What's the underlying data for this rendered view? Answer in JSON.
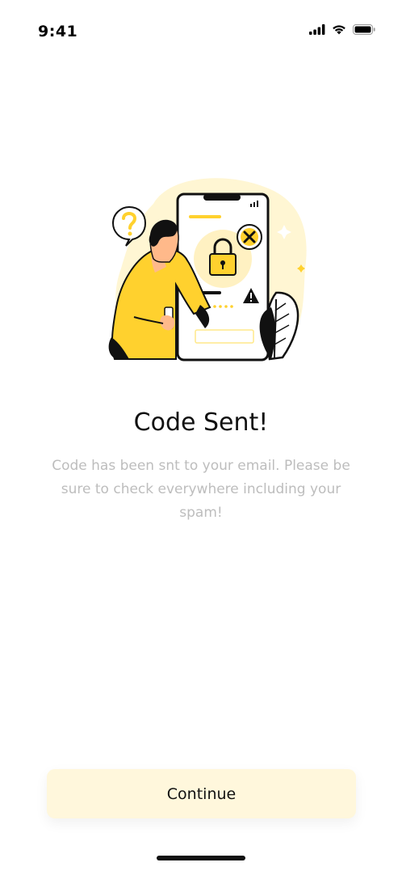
{
  "status_bar": {
    "time": "9:41",
    "icons": [
      "cellular-signal-icon",
      "wifi-icon",
      "battery-icon"
    ]
  },
  "illustration": {
    "description_icons": [
      "question-bubble-icon",
      "lock-icon",
      "error-x-icon",
      "warning-icon",
      "leaf-icon",
      "person-with-phone-icon"
    ],
    "colors": {
      "accent": "#FFD12E",
      "accent_light": "#FFF6D3",
      "ink": "#111111"
    }
  },
  "content": {
    "title": "Code Sent!",
    "subtitle": "Code has been snt to your email. Please be sure to check everywhere including your spam!"
  },
  "actions": {
    "continue_label": "Continue"
  },
  "colors": {
    "button_bg": "#FFF7DC",
    "subtitle_text": "#BDBDBD"
  }
}
